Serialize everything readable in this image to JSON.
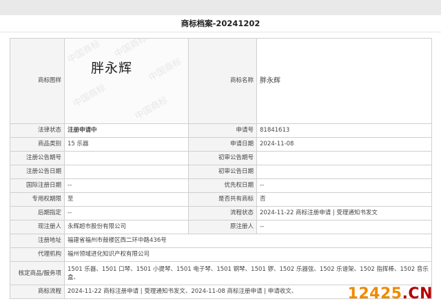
{
  "header": {
    "title": "商标档案-20241202"
  },
  "mark": {
    "image_label": "商标图样",
    "image_text": "胖永辉",
    "watermark": "中国商标",
    "name_label": "商标名称",
    "name_value": "胖永辉"
  },
  "rows": [
    {
      "l1": "法律状态",
      "v1": "注册申请中",
      "l2": "申请号",
      "v2": "81841613"
    },
    {
      "l1": "商品类别",
      "v1": "15 乐器",
      "l2": "申请日期",
      "v2": "2024-11-08"
    },
    {
      "l1": "注册公告期号",
      "v1": "",
      "l2": "初审公告期号",
      "v2": ""
    },
    {
      "l1": "注册公告日期",
      "v1": "",
      "l2": "初审公告日期",
      "v2": ""
    },
    {
      "l1": "国际注册日期",
      "v1": "--",
      "l2": "优先权日期",
      "v2": "--"
    },
    {
      "l1": "专用权期限",
      "v1": "至",
      "l2": "是否共有商标",
      "v2": "否"
    },
    {
      "l1": "后期指定",
      "v1": "--",
      "l2": "流程状态",
      "v2": "2024-11-22 商标注册申请 | 受理通知书发文"
    },
    {
      "l1": "现注册人",
      "v1": "永辉超市股份有限公司",
      "l2": "原注册人",
      "v2": "--"
    }
  ],
  "address": {
    "label": "注册地址",
    "value": "福建省福州市鼓楼区西二环中路436号"
  },
  "agency": {
    "label": "代理机构",
    "value": "福州领域进化知识产权有限公司"
  },
  "goods": {
    "label": "核定商品/服务项",
    "value": "1501 乐器、1501 口琴、1501 小提琴、1501 电子琴、1501 钢琴、1501 锣、1502 乐器弦、1502 乐谱架、1502 指挥棒、1502 音乐盒、"
  },
  "process": {
    "label": "商标流程",
    "value": "2024-11-22 商标注册申请 | 受理通知书发文、2024-11-08 商标注册申请 | 申请收文、"
  },
  "watermark_logo": {
    "part1": "12425",
    "part2": ".CN"
  },
  "colors": {
    "status": "#e07b24",
    "label_bg": "#f4f4f4",
    "border": "#cfcfcf"
  }
}
